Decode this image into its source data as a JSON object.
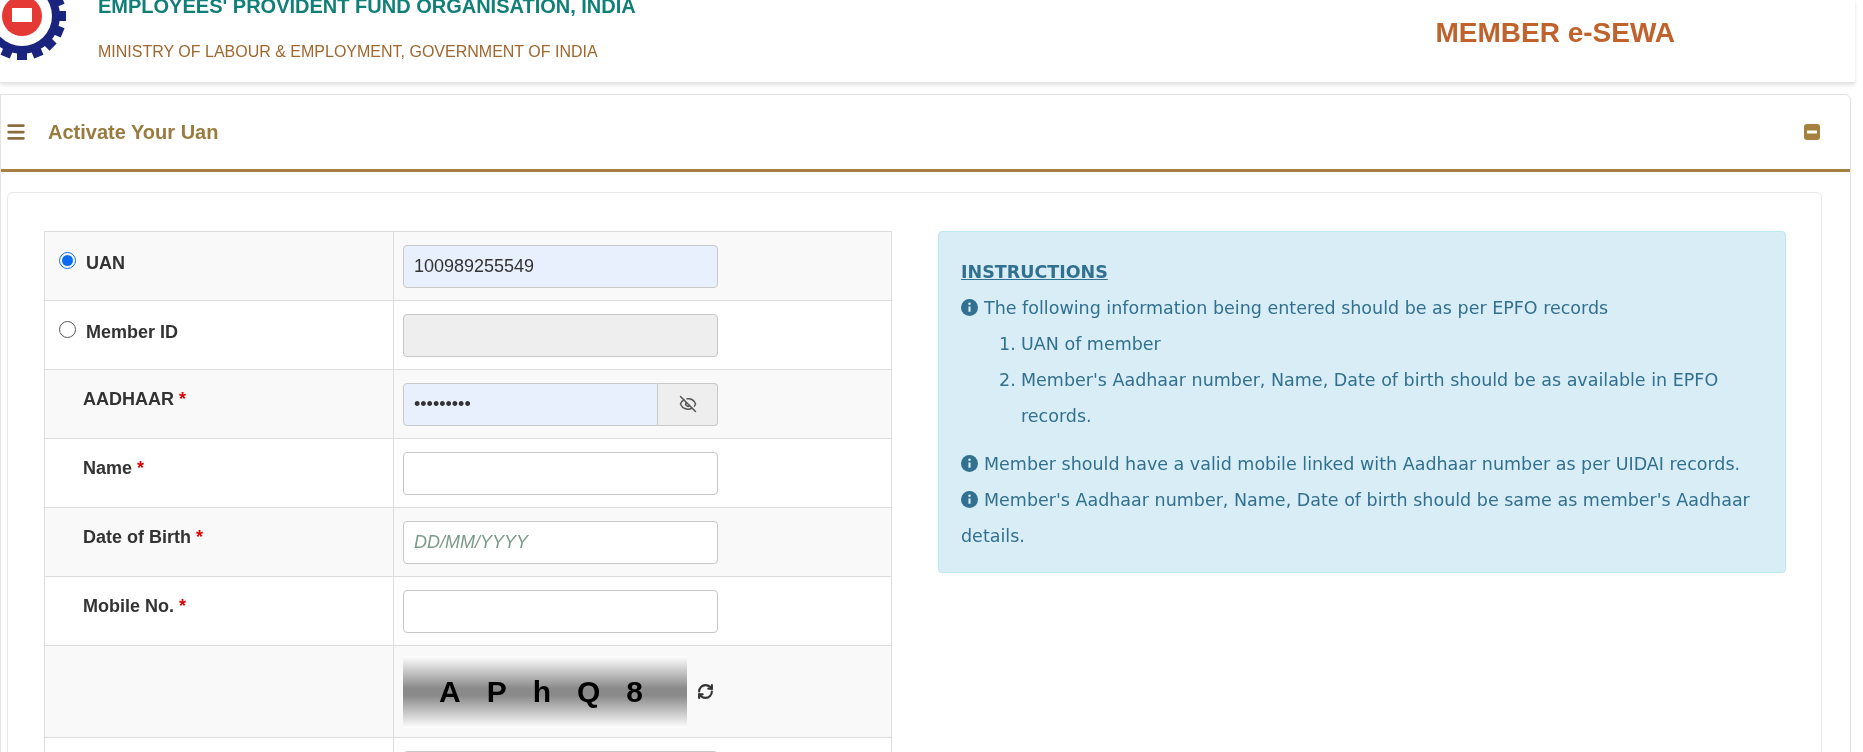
{
  "header": {
    "title": "EMPLOYEES' PROVIDENT FUND ORGANISATION, INDIA",
    "subtitle": "MINISTRY OF LABOUR & EMPLOYMENT, GOVERNMENT OF INDIA",
    "portal": "MEMBER e-SEWA"
  },
  "panel": {
    "title": "Activate Your Uan",
    "expanded": true
  },
  "form": {
    "rows": [
      {
        "kind": "radio",
        "label": "UAN",
        "selected": true,
        "value": "100989255549",
        "filled": true
      },
      {
        "kind": "radio",
        "label": "Member ID",
        "selected": false,
        "disabled": true
      },
      {
        "kind": "password",
        "label": "AADHAAR",
        "required_mark": "*",
        "value": "•••••••••",
        "filled": true
      },
      {
        "kind": "text",
        "label": "Name",
        "required_mark": "*"
      },
      {
        "kind": "text",
        "label": "Date of Birth",
        "required_mark": "*",
        "placeholder": "DD/MM/YYYY"
      },
      {
        "kind": "text",
        "label": "Mobile No.",
        "required_mark": "*"
      },
      {
        "kind": "captcha",
        "captcha": "APhQ8"
      },
      {
        "kind": "text"
      }
    ]
  },
  "instructions": {
    "title": "INSTRUCTIONS",
    "blocks": [
      {
        "text": "The following information being entered should be as per EPFO records",
        "list": [
          {
            "number": "1.",
            "text": "UAN of member"
          },
          {
            "number": "2.",
            "text": "Member's Aadhaar number, Name, Date of birth should be as available in EPFO records."
          }
        ]
      },
      {
        "text": "Member should have a valid mobile linked with Aadhaar number as per UIDAI records."
      },
      {
        "text": "Member's Aadhaar number, Name, Date of birth should be same as member's Aadhaar details."
      }
    ]
  }
}
